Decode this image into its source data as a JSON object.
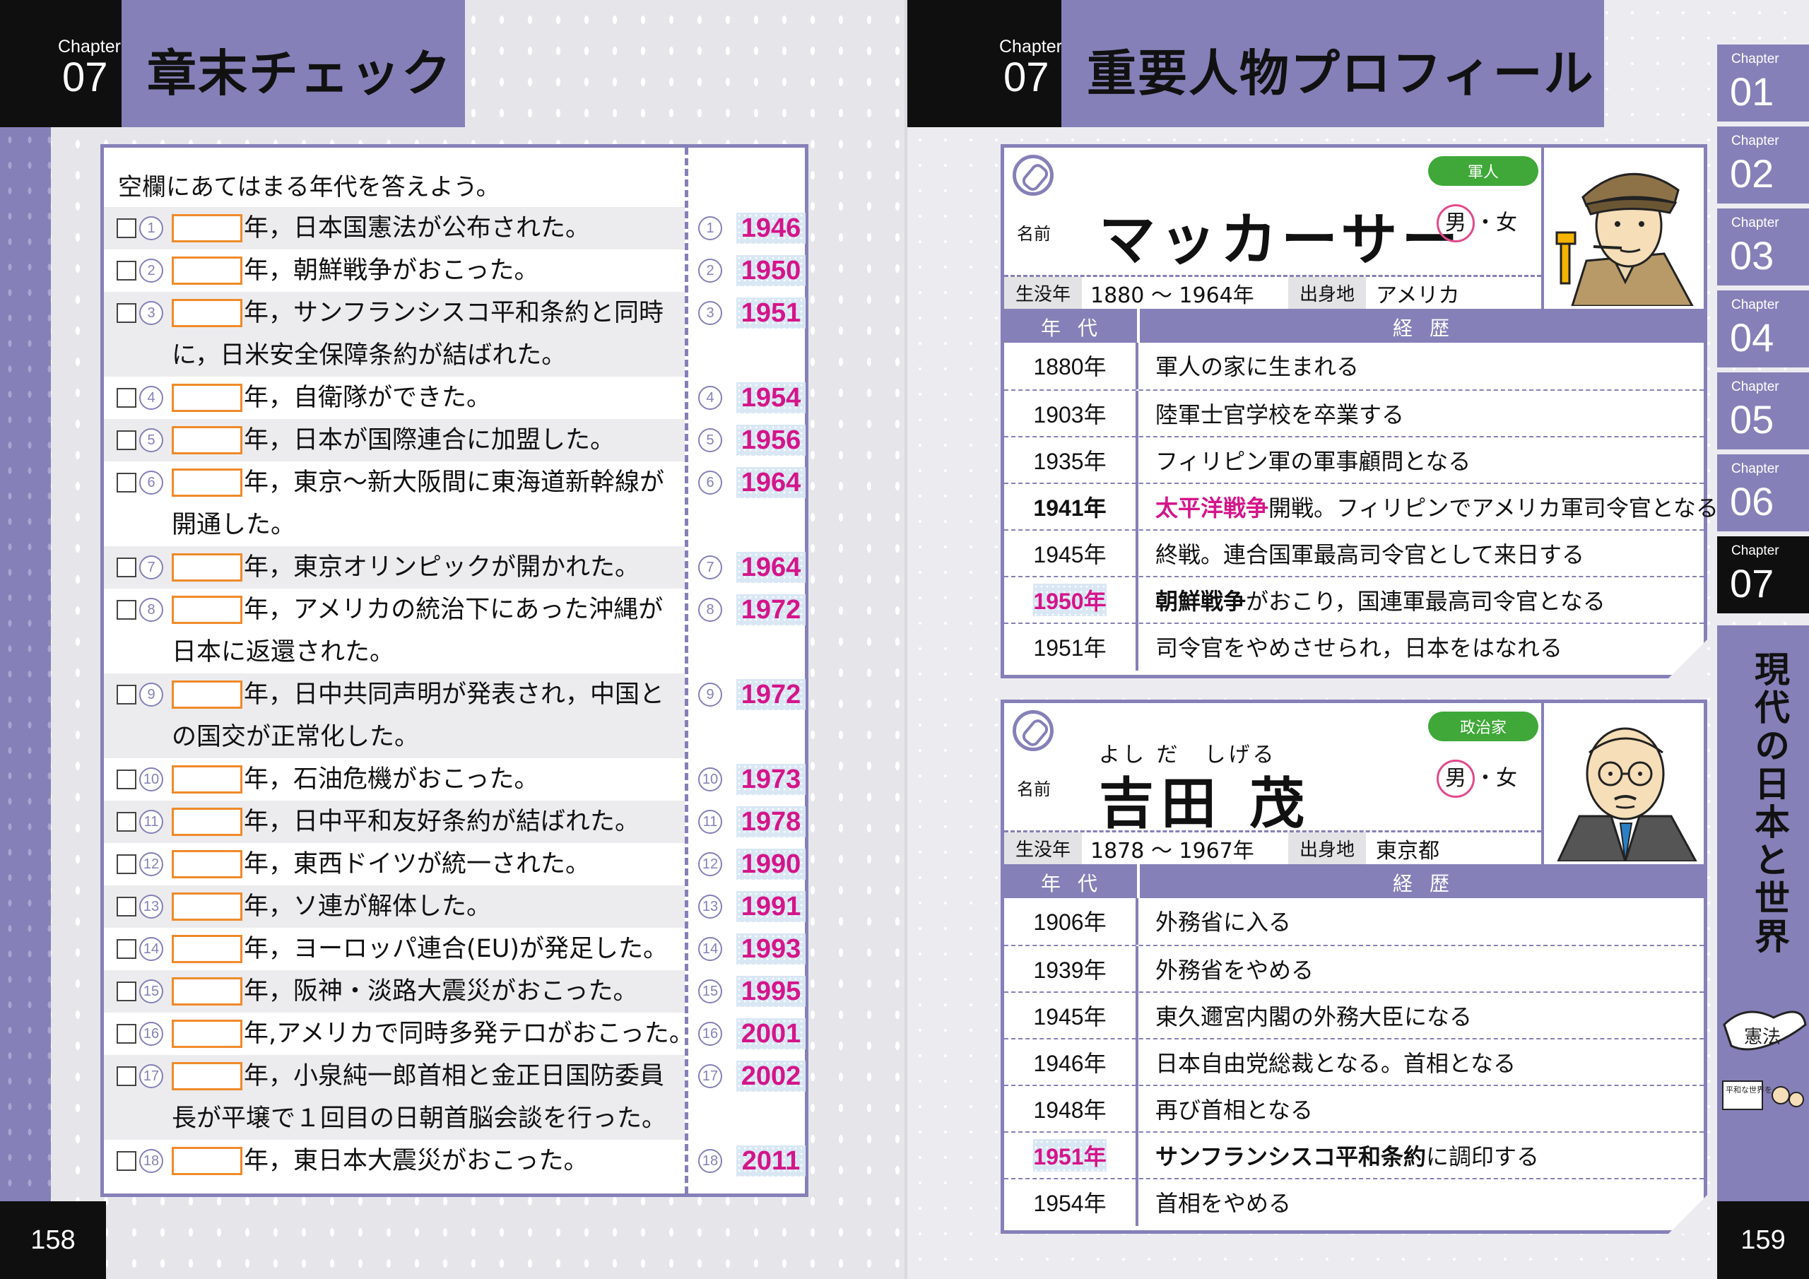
{
  "left": {
    "chapter_word": "Chapter",
    "chapter_num": "07",
    "title": "章末チェック",
    "instruction": "空欄にあてはまる年代を答えよう。",
    "questions": [
      {
        "n": "1",
        "line1": "年，日本国憲法が公布された。",
        "line2": "",
        "answer": "1946"
      },
      {
        "n": "2",
        "line1": "年，朝鮮戦争がおこった。",
        "line2": "",
        "answer": "1950"
      },
      {
        "n": "3",
        "line1": "年，サンフランシスコ平和条約と同時",
        "line2": "に，日米安全保障条約が結ばれた。",
        "answer": "1951"
      },
      {
        "n": "4",
        "line1": "年，自衛隊ができた。",
        "line2": "",
        "answer": "1954"
      },
      {
        "n": "5",
        "line1": "年，日本が国際連合に加盟した。",
        "line2": "",
        "answer": "1956"
      },
      {
        "n": "6",
        "line1": "年，東京～新大阪間に東海道新幹線が",
        "line2": "開通した。",
        "answer": "1964"
      },
      {
        "n": "7",
        "line1": "年，東京オリンピックが開かれた。",
        "line2": "",
        "answer": "1964"
      },
      {
        "n": "8",
        "line1": "年，アメリカの統治下にあった沖縄が",
        "line2": "日本に返還された。",
        "answer": "1972"
      },
      {
        "n": "9",
        "line1": "年，日中共同声明が発表され，中国と",
        "line2": "の国交が正常化した。",
        "answer": "1972"
      },
      {
        "n": "10",
        "line1": "年，石油危機がおこった。",
        "line2": "",
        "answer": "1973"
      },
      {
        "n": "11",
        "line1": "年，日中平和友好条約が結ばれた。",
        "line2": "",
        "answer": "1978"
      },
      {
        "n": "12",
        "line1": "年，東西ドイツが統一された。",
        "line2": "",
        "answer": "1990"
      },
      {
        "n": "13",
        "line1": "年，ソ連が解体した。",
        "line2": "",
        "answer": "1991"
      },
      {
        "n": "14",
        "line1": "年，ヨーロッパ連合(EU)が発足した。",
        "line2": "",
        "answer": "1993"
      },
      {
        "n": "15",
        "line1": "年，阪神・淡路大震災がおこった。",
        "line2": "",
        "answer": "1995"
      },
      {
        "n": "16",
        "line1": "年,アメリカで同時多発テロがおこった。",
        "line2": "",
        "answer": "2001"
      },
      {
        "n": "17",
        "line1": "年，小泉純一郎首相と金正日国防委員",
        "line2": "長が平壌で１回目の日朝首脳会談を行った。",
        "answer": "2002"
      },
      {
        "n": "18",
        "line1": "年，東日本大震災がおこった。",
        "line2": "",
        "answer": "2011"
      }
    ],
    "page_number": "158"
  },
  "right": {
    "chapter_word": "Chapter",
    "chapter_num": "07",
    "title": "重要人物プロフィール",
    "profiles": [
      {
        "role": "軍人",
        "name_label": "名前",
        "name": "マッカーサー",
        "ruby": "",
        "gender_male": "男",
        "gender_sep": "・",
        "gender_female": "女",
        "lifespan_label": "生没年",
        "lifespan": "1880 ～ 1964年",
        "birthplace_label": "出身地",
        "birthplace": "アメリカ",
        "col_year": "年代",
        "col_history": "経歴",
        "rows": [
          {
            "year": "1880年",
            "pre": "",
            "strong": "",
            "post": "軍人の家に生まれる",
            "year_bold": false,
            "year_hl": false,
            "strong_pink": false
          },
          {
            "year": "1903年",
            "pre": "",
            "strong": "",
            "post": "陸軍士官学校を卒業する",
            "year_bold": false,
            "year_hl": false,
            "strong_pink": false
          },
          {
            "year": "1935年",
            "pre": "",
            "strong": "",
            "post": "フィリピン軍の軍事顧問となる",
            "year_bold": false,
            "year_hl": false,
            "strong_pink": false
          },
          {
            "year": "1941年",
            "pre": "",
            "strong": "太平洋戦争",
            "post": "開戦。フィリピンでアメリカ軍司令官となる",
            "year_bold": true,
            "year_hl": false,
            "strong_pink": true
          },
          {
            "year": "1945年",
            "pre": "",
            "strong": "",
            "post": "終戦。連合国軍最高司令官として来日する",
            "year_bold": false,
            "year_hl": false,
            "strong_pink": false
          },
          {
            "year": "1950年",
            "pre": "",
            "strong": "朝鮮戦争",
            "post": "がおこり，国連軍最高司令官となる",
            "year_bold": false,
            "year_hl": true,
            "strong_pink": false
          },
          {
            "year": "1951年",
            "pre": "",
            "strong": "",
            "post": "司令官をやめさせられ，日本をはなれる",
            "year_bold": false,
            "year_hl": false,
            "strong_pink": false
          }
        ]
      },
      {
        "role": "政治家",
        "name_label": "名前",
        "name": "吉田 茂",
        "ruby": "よし だ　しげる",
        "gender_male": "男",
        "gender_sep": "・",
        "gender_female": "女",
        "lifespan_label": "生没年",
        "lifespan": "1878 ～ 1967年",
        "birthplace_label": "出身地",
        "birthplace": "東京都",
        "col_year": "年代",
        "col_history": "経歴",
        "rows": [
          {
            "year": "1906年",
            "pre": "",
            "strong": "",
            "post": "外務省に入る",
            "year_bold": false,
            "year_hl": false,
            "strong_pink": false
          },
          {
            "year": "1939年",
            "pre": "",
            "strong": "",
            "post": "外務省をやめる",
            "year_bold": false,
            "year_hl": false,
            "strong_pink": false
          },
          {
            "year": "1945年",
            "pre": "",
            "strong": "",
            "post": "東久邇宮内閣の外務大臣になる",
            "year_bold": false,
            "year_hl": false,
            "strong_pink": false
          },
          {
            "year": "1946年",
            "pre": "",
            "strong": "",
            "post": "日本自由党総裁となる。首相となる",
            "year_bold": false,
            "year_hl": false,
            "strong_pink": false
          },
          {
            "year": "1948年",
            "pre": "",
            "strong": "",
            "post": "再び首相となる",
            "year_bold": false,
            "year_hl": false,
            "strong_pink": false
          },
          {
            "year": "1951年",
            "pre": "",
            "strong": "サンフランシスコ平和条約",
            "post": "に調印する",
            "year_bold": false,
            "year_hl": true,
            "strong_pink": false
          },
          {
            "year": "1954年",
            "pre": "",
            "strong": "",
            "post": "首相をやめる",
            "year_bold": false,
            "year_hl": false,
            "strong_pink": false
          }
        ]
      }
    ],
    "side_tabs": [
      {
        "word": "Chapter",
        "num": "01"
      },
      {
        "word": "Chapter",
        "num": "02"
      },
      {
        "word": "Chapter",
        "num": "03"
      },
      {
        "word": "Chapter",
        "num": "04"
      },
      {
        "word": "Chapter",
        "num": "05"
      },
      {
        "word": "Chapter",
        "num": "06"
      },
      {
        "word": "Chapter",
        "num": "07"
      }
    ],
    "side_title": "現代の日本と世界",
    "dove_text": "憲法",
    "dove_sign": "平和な世界を",
    "page_number": "159"
  },
  "colors": {
    "accent_purple": "#8580b8",
    "answer_pink": "#d4158a",
    "blank_orange": "#f08a2a",
    "badge_green": "#3fa838"
  }
}
